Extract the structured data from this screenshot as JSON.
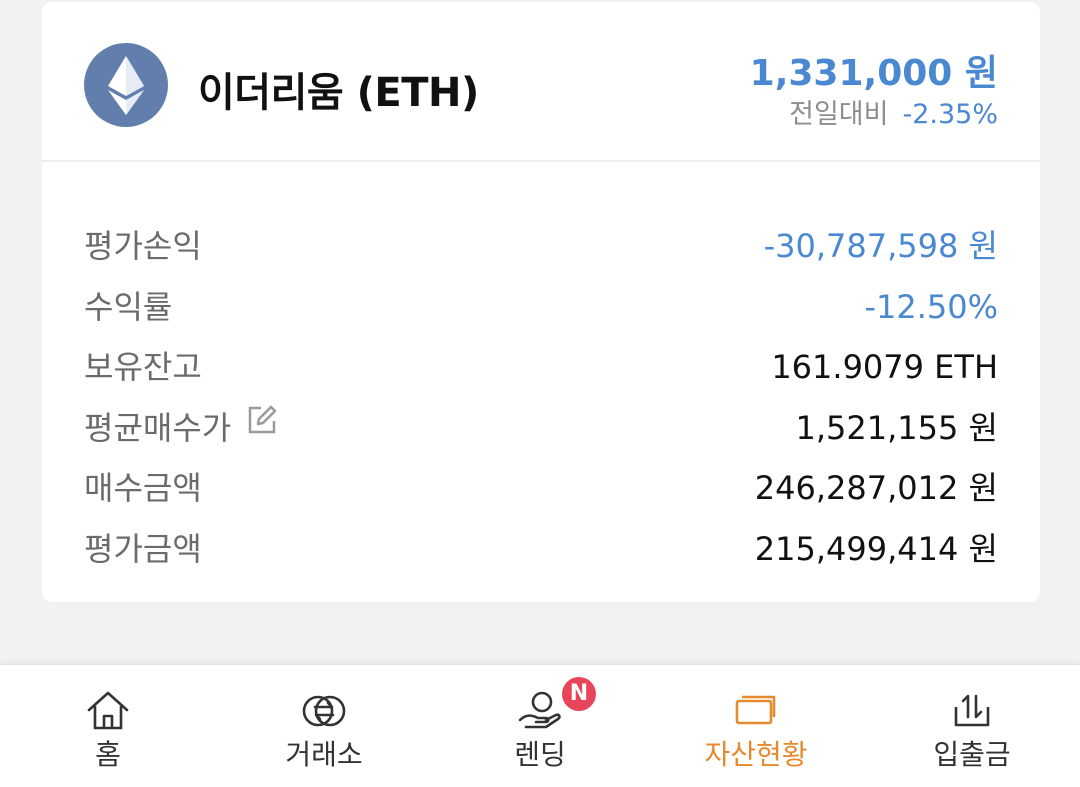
{
  "asset": {
    "name": "이더리움 (ETH)",
    "price": "1,331,000 원",
    "change_label": "전일대비",
    "change_value": "-2.35%",
    "logo_icon": "ethereum-logo",
    "logo_color": "#627eac"
  },
  "details": [
    {
      "label": "평가손익",
      "value": "-30,787,598 원"
    },
    {
      "label": "수익률",
      "value": "-12.50%"
    },
    {
      "label": "보유잔고",
      "value": "161.9079 ETH"
    },
    {
      "label": "평균매수가",
      "value": "1,521,155 원"
    },
    {
      "label": "매수금액",
      "value": "246,287,012 원"
    },
    {
      "label": "평가금액",
      "value": "215,499,414 원"
    }
  ],
  "nav": {
    "items": [
      {
        "label": "홈",
        "icon": "home-icon"
      },
      {
        "label": "거래소",
        "icon": "exchange-icon"
      },
      {
        "label": "렌딩",
        "icon": "lending-icon",
        "badge": "N"
      },
      {
        "label": "자산현황",
        "icon": "wallet-icon",
        "active": true
      },
      {
        "label": "입출금",
        "icon": "deposit-withdraw-icon"
      }
    ]
  },
  "colors": {
    "negative": "#4a88d1",
    "active": "#e68a2e",
    "badge": "#e8455a"
  }
}
